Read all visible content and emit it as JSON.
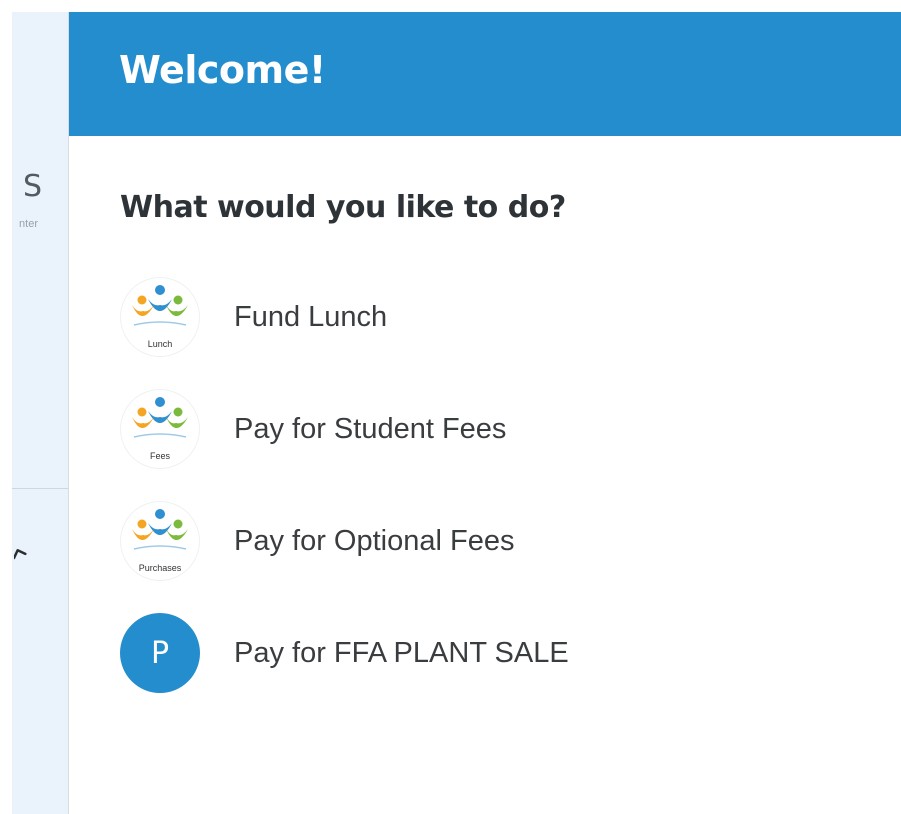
{
  "sidebar": {
    "logo_letter": "S",
    "logo_subtext": "nter",
    "chevron_icon": "chevron-up-icon"
  },
  "header": {
    "title": "Welcome!",
    "background_color": "#238dcd"
  },
  "main": {
    "prompt": "What would you like to do?",
    "actions": [
      {
        "label": "Fund Lunch",
        "icon": "people-logo-icon",
        "icon_caption": "Lunch"
      },
      {
        "label": "Pay for Student Fees",
        "icon": "people-logo-icon",
        "icon_caption": "Fees"
      },
      {
        "label": "Pay for Optional Fees",
        "icon": "people-logo-icon",
        "icon_caption": "Purchases"
      },
      {
        "label": "Pay for FFA PLANT SALE",
        "icon": "letter-avatar-icon",
        "icon_letter": "P",
        "icon_color": "#238dcd"
      }
    ]
  },
  "colors": {
    "accent_blue": "#238dcd",
    "logo_orange": "#f4a623",
    "logo_green": "#7cba3d",
    "logo_blue": "#2f8fd0"
  }
}
